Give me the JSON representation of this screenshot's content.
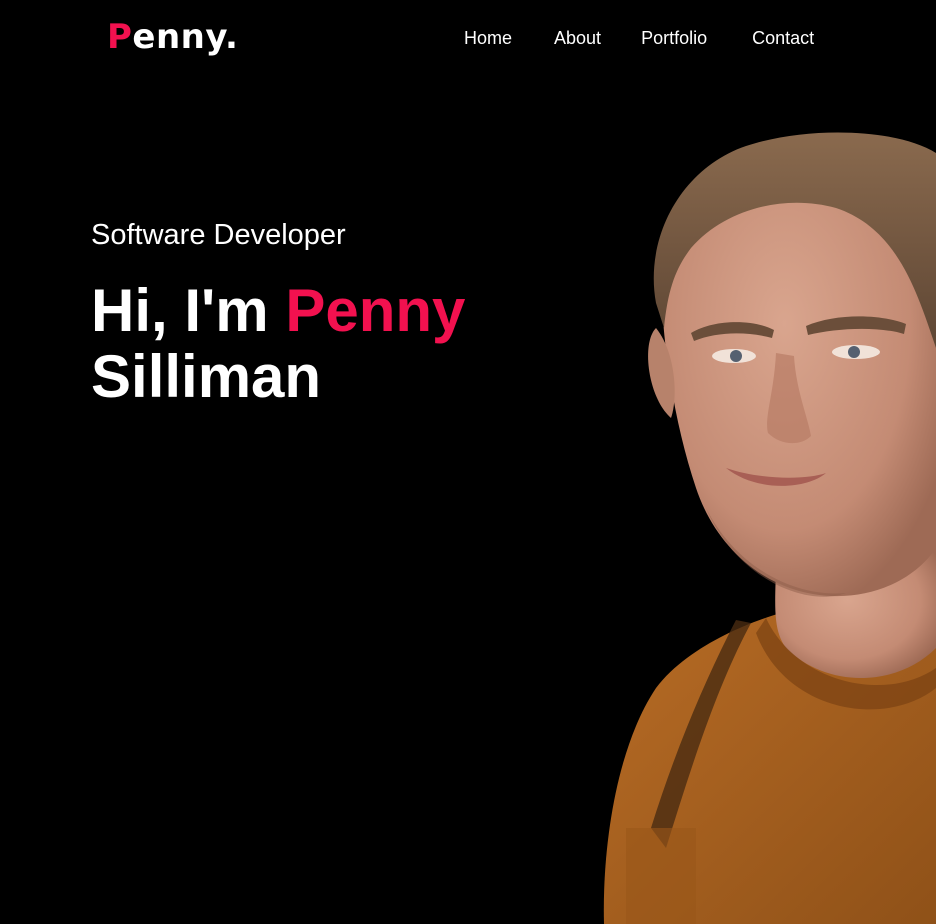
{
  "nav": {
    "logo": {
      "first_letter": "P",
      "rest": "enny",
      "dot": "."
    },
    "links": [
      "Home",
      "About",
      "Portfolio",
      "Contact"
    ]
  },
  "hero": {
    "subtitle": "Software Developer",
    "greeting": "Hi, I'm",
    "first_name": "Penny",
    "last_name": "Silliman"
  },
  "portrait": {
    "alt": "portrait photo"
  },
  "colors": {
    "background": "#000000",
    "text": "#ffffff",
    "accent": "#f2114f",
    "shirt": "#a8611f"
  }
}
